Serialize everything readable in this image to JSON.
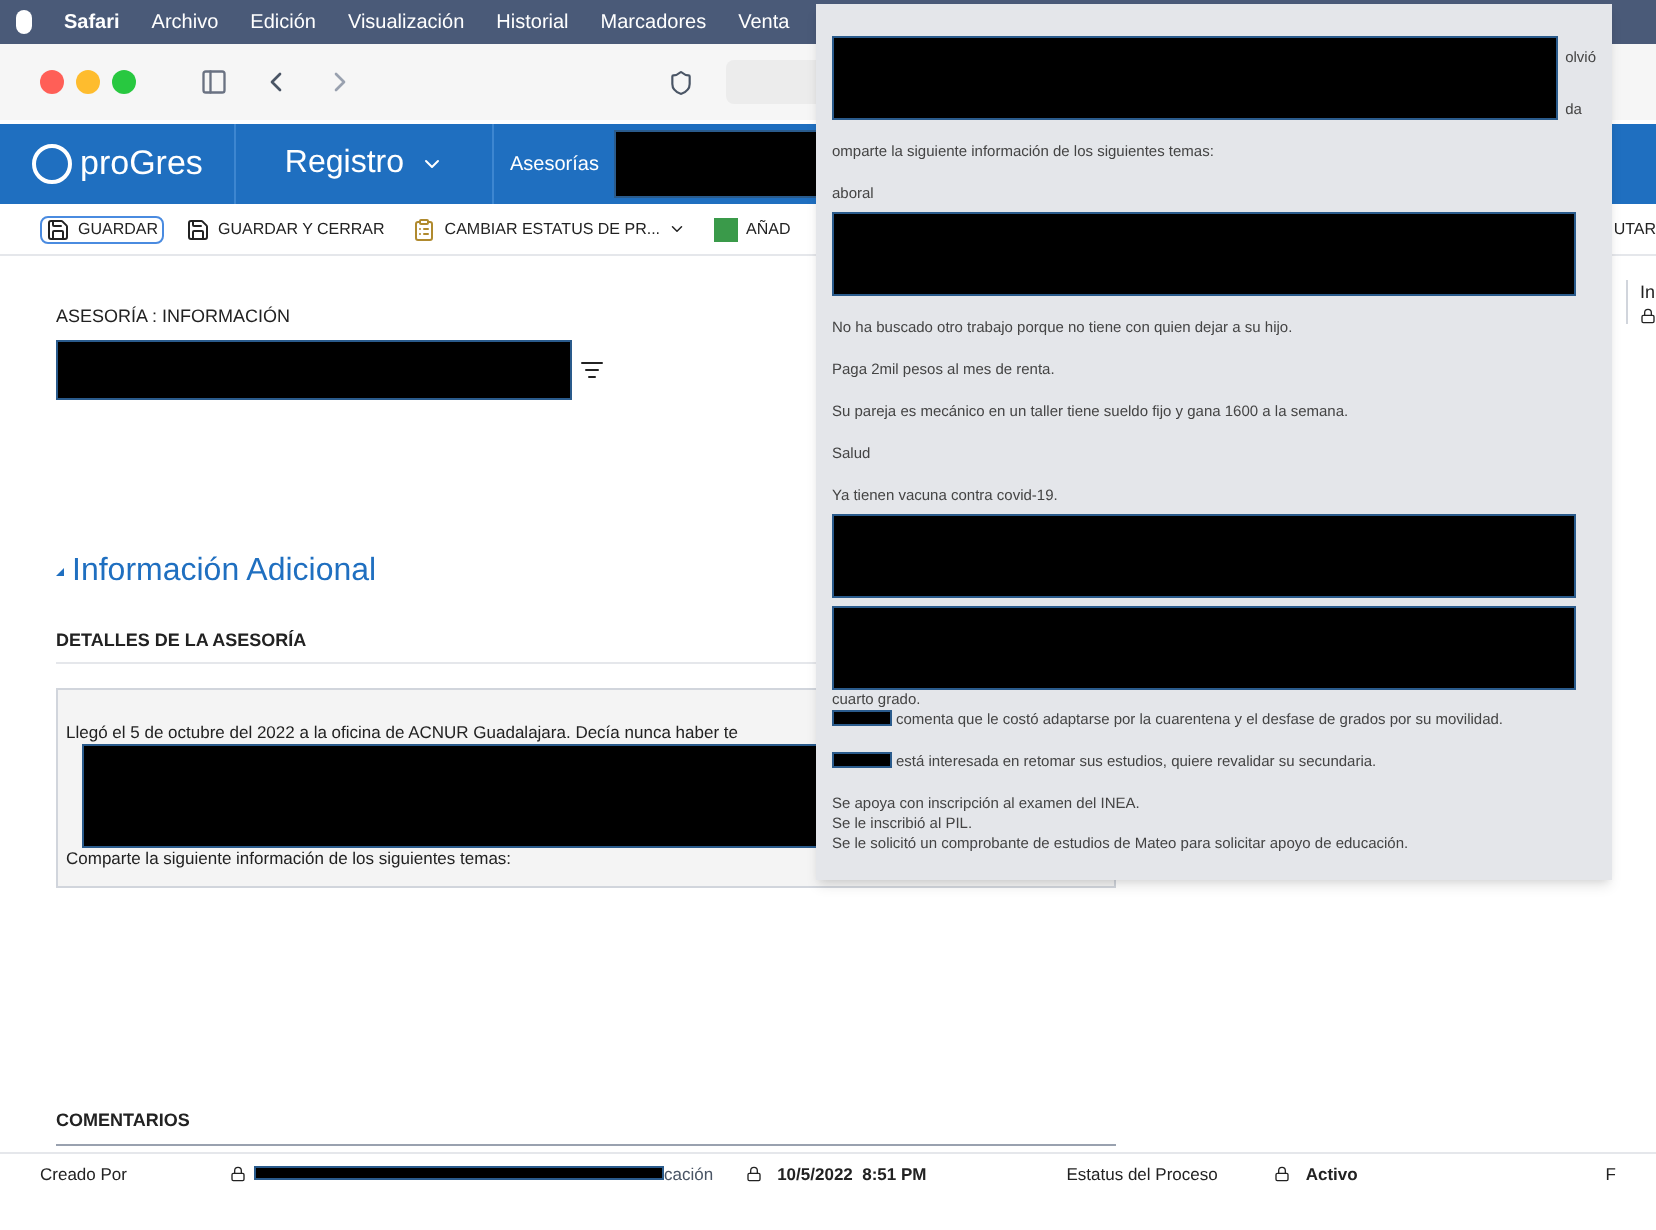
{
  "menu_bar": [
    "Safari",
    "Archivo",
    "Edición",
    "Visualización",
    "Historial",
    "Marcadores",
    "Venta"
  ],
  "nav": {
    "logo": "proGres",
    "module": "Registro",
    "section": "Asesorías"
  },
  "toolbar": [
    {
      "label": "GUARDAR",
      "selected": true,
      "kind": "save"
    },
    {
      "label": "GUARDAR Y CERRAR",
      "selected": false,
      "kind": "save-close"
    },
    {
      "label": "CAMBIAR ESTATUS DE PR...",
      "selected": false,
      "kind": "status"
    },
    {
      "label": "AÑAD",
      "selected": false,
      "kind": "add"
    }
  ],
  "toolbar_right": "UTAR",
  "side_label": "In",
  "breadcrumb": "ASESORÍA : INFORMACIÓN",
  "section_title": "Información Adicional",
  "details_heading": "DETALLES DE LA ASESORÍA",
  "details_lines": [
    {
      "kind": "text",
      "text": "Llegó el 5 de octubre del 2022 a la oficina de ACNUR Guadalajara. Decía nunca haber te"
    },
    {
      "kind": "redaction"
    },
    {
      "kind": "text",
      "text": "Comparte la siguiente información de los siguientes temas:"
    }
  ],
  "comments_heading": "COMENTARIOS",
  "footer": {
    "created_by": "Creado Por",
    "cut_label": "cación",
    "date": "10/5/2022  8:51 PM",
    "status_label": "Estatus del Proceso",
    "status": "Activo",
    "right_cut": "F"
  },
  "popup_lines": [
    {
      "kind": "redaction",
      "tail": "olvió",
      "tail2": "da"
    },
    {
      "kind": "blank"
    },
    {
      "kind": "text",
      "text": "omparte la siguiente información de los siguientes temas:"
    },
    {
      "kind": "blank"
    },
    {
      "kind": "text",
      "text": "aboral"
    },
    {
      "kind": "redaction"
    },
    {
      "kind": "blank"
    },
    {
      "kind": "text",
      "text": "No ha buscado otro trabajo porque no tiene con quien dejar a su hijo."
    },
    {
      "kind": "blank"
    },
    {
      "kind": "text",
      "text": "Paga 2mil pesos al mes de renta."
    },
    {
      "kind": "blank"
    },
    {
      "kind": "text",
      "text": "Su pareja es mecánico en un taller tiene sueldo fijo y gana 1600 a la semana."
    },
    {
      "kind": "blank"
    },
    {
      "kind": "text",
      "text": "Salud"
    },
    {
      "kind": "blank"
    },
    {
      "kind": "text",
      "text": "Ya tienen vacuna contra covid-19."
    },
    {
      "kind": "redaction"
    },
    {
      "kind": "redaction"
    },
    {
      "kind": "text",
      "text": "cuarto grado."
    },
    {
      "kind": "lead-redaction",
      "text": "comenta que le costó adaptarse por  la cuarentena y el desfase de grados por su movilidad."
    },
    {
      "kind": "blank"
    },
    {
      "kind": "lead-redaction",
      "text": "está interesada en retomar sus estudios, quiere revalidar su secundaria."
    },
    {
      "kind": "blank"
    },
    {
      "kind": "text",
      "text": "Se apoya con inscripción al examen del INEA."
    },
    {
      "kind": "text",
      "text": "Se le inscribió al PIL."
    },
    {
      "kind": "text",
      "text": "Se le solicitó un comprobante de estudios de Mateo para solicitar apoyo de educación."
    }
  ]
}
